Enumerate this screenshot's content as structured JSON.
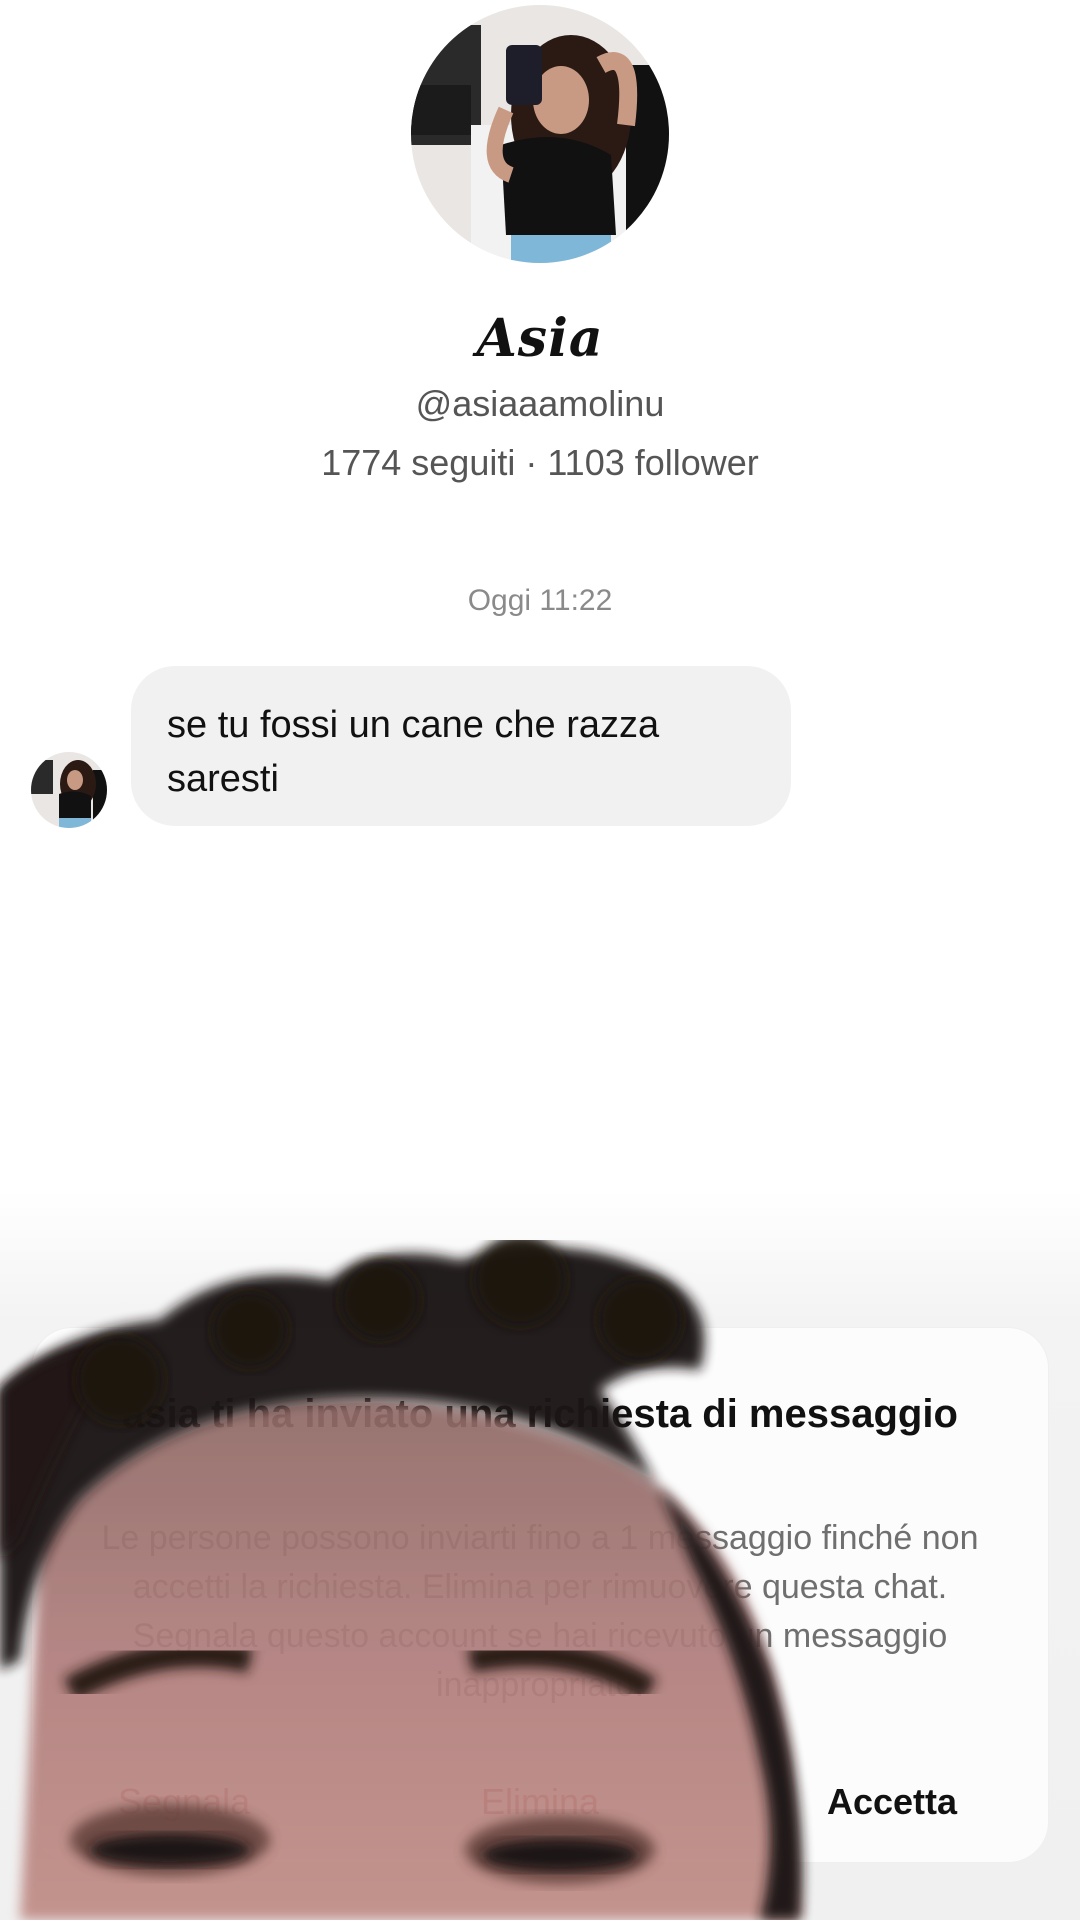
{
  "profile": {
    "name": "Asia",
    "handle": "@asiaaamolinu",
    "stats": "1774 seguiti · 1103 follower"
  },
  "conversation": {
    "timestamp": "Oggi 11:22",
    "messages": [
      {
        "text": "se tu fossi un cane che razza saresti"
      }
    ]
  },
  "request_card": {
    "title": "asia ti ha inviato una richiesta di messaggio",
    "body": "Le persone possono inviarti fino a 1 messaggio finché non accetti la richiesta. Elimina per rimuovere questa chat. Segnala questo account se hai ricevuto un messaggio inappropriato.",
    "actions": {
      "report": "Segnala",
      "delete": "Elimina",
      "accept": "Accetta"
    }
  },
  "colors": {
    "bubble": "#f1f1f1",
    "danger": "#c04040",
    "muted": "#8a8a8a"
  }
}
